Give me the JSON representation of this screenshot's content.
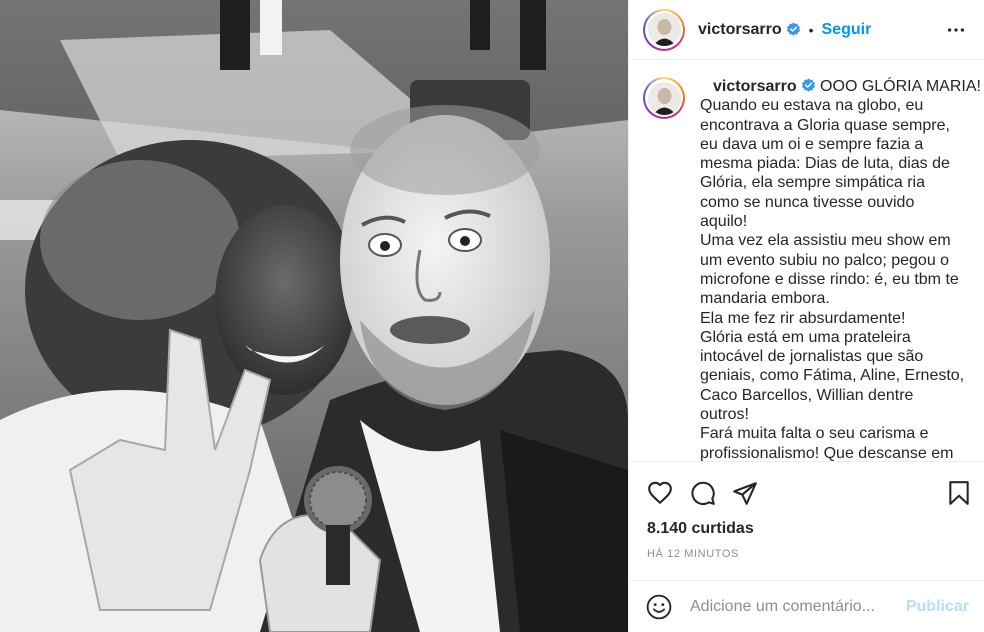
{
  "post": {
    "username": "victorsarro",
    "dot": "•",
    "follow_label": "Seguir",
    "caption_lines": [
      "OOO GLÓRIA MARIA!",
      "Quando eu estava na globo, eu",
      "encontrava a Gloria quase sempre,",
      "eu dava um oi e sempre fazia a",
      "mesma piada: Dias de luta, dias de",
      "Glória, ela sempre simpática ria",
      "como se nunca tivesse ouvido",
      "aquilo!",
      "Uma vez ela assistiu meu show em",
      "um evento subiu no palco; pegou o",
      "microfone e disse rindo: é, eu tbm te",
      "mandaria embora.",
      "Ela me fez rir absurdamente!",
      "Glória está em uma prateleira",
      "intocável de jornalistas que são",
      "geniais, como Fátima, Aline, Ernesto,",
      "Caco Barcellos, Willian dentre",
      "outros!",
      "Fará muita falta o seu carisma e",
      "profissionalismo! Que descanse em"
    ],
    "likes": "8.140 curtidas",
    "time_ago": "HÁ 12 MINUTOS",
    "comment_placeholder": "Adicione um comentário...",
    "publish_label": "Publicar"
  },
  "icons": {
    "like": "heart-icon",
    "comment": "comment-icon",
    "share": "paper-plane-icon",
    "save": "bookmark-icon",
    "more": "more-options-icon",
    "emoji": "emoji-icon",
    "verified": "verified-badge-icon"
  },
  "colors": {
    "accent": "#0095f6",
    "publish_disabled": "#b2dffc",
    "verified": "#3897f0",
    "muted": "#8e8e8e",
    "text": "#262626"
  }
}
